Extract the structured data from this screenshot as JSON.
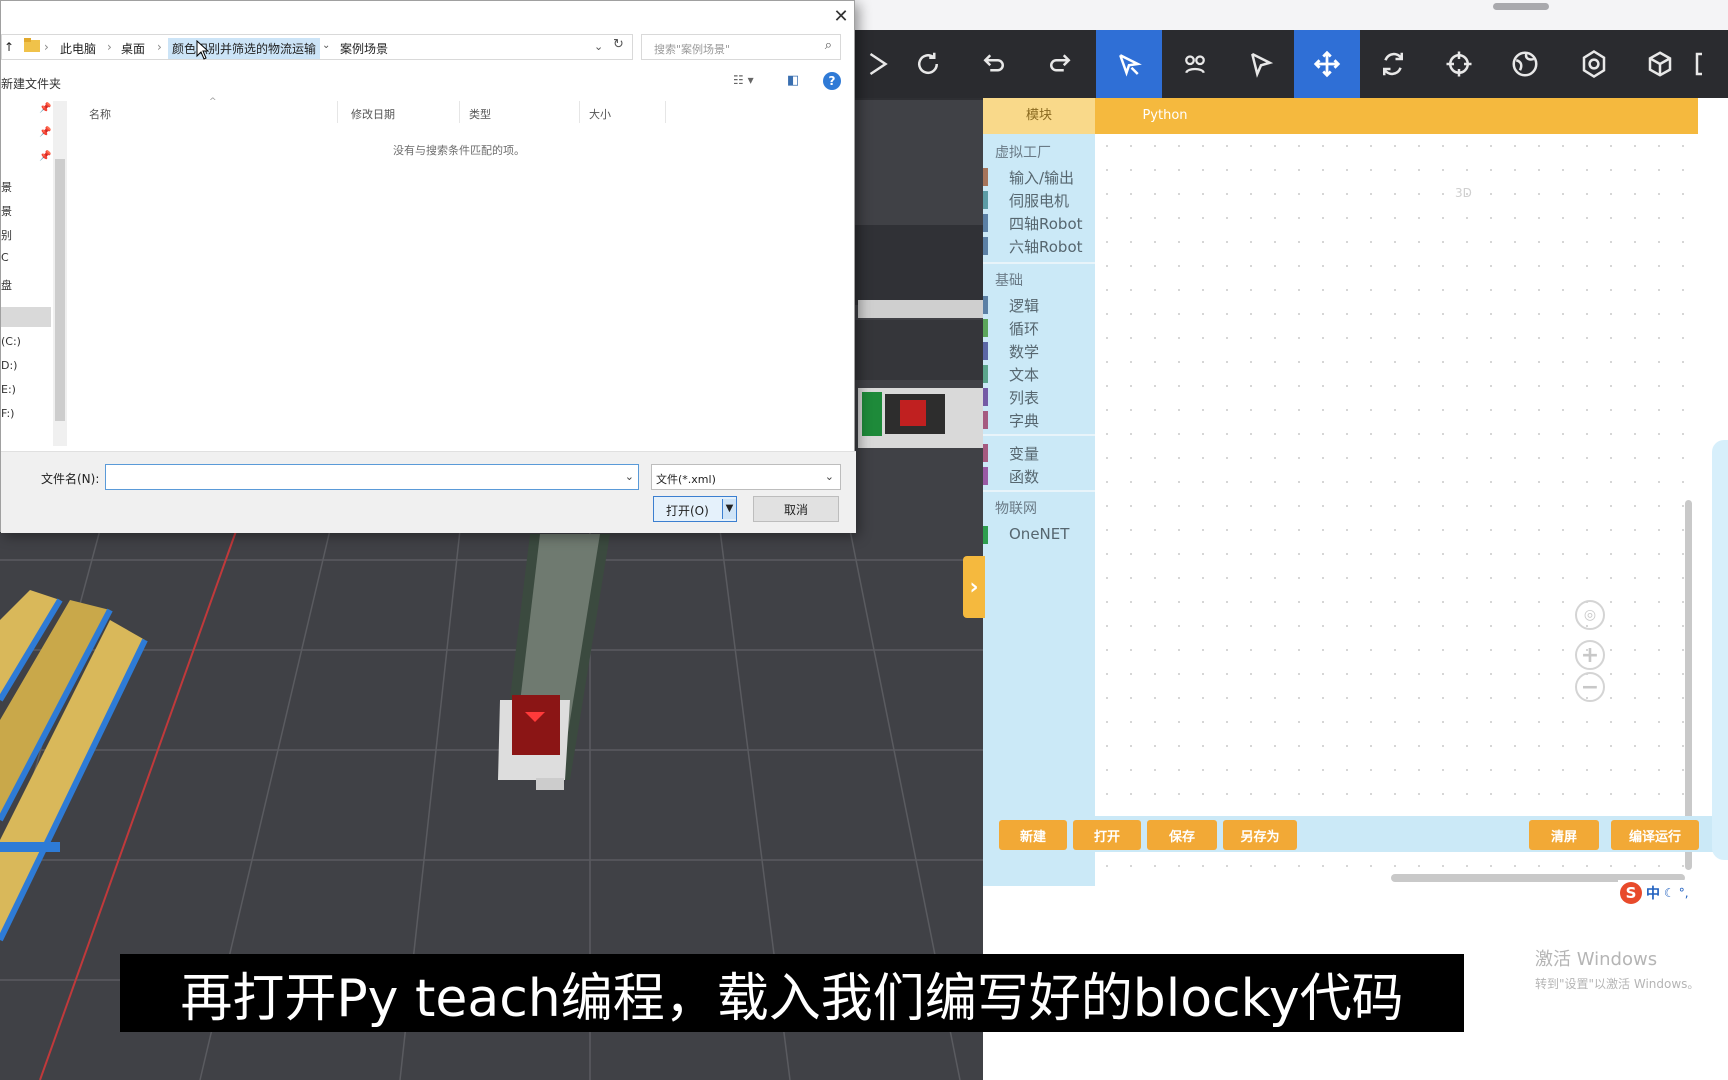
{
  "dialog": {
    "address": {
      "crumbs": [
        "此电脑",
        "桌面"
      ],
      "selected_folder": "颜色识别并筛选的物流运输",
      "subfolder": "案例场景"
    },
    "search_placeholder": "搜索\"案例场景\"",
    "new_folder": "新建文件夹",
    "columns": [
      "名称",
      "修改日期",
      "类型",
      "大小"
    ],
    "empty_message": "没有与搜索条件匹配的项。",
    "nav_items": [
      "景",
      "景",
      "别",
      "C",
      "盘",
      "(C:)",
      "D:)",
      "E:)",
      "F:)"
    ],
    "filename_label": "文件名(N):",
    "filename_value": "",
    "filetype": "文件(*.xml)",
    "open_button": "打开(O)",
    "cancel_button": "取消"
  },
  "toolbar": {
    "active_indices": [
      4,
      7
    ],
    "icons": [
      "play-icon",
      "redo-circle-icon",
      "undo-icon",
      "redo-icon",
      "magic-select-icon",
      "multi-paw-icon",
      "pointer-icon",
      "move-icon",
      "rotate-icon",
      "crosshair-icon",
      "globe-icon",
      "settings-icon",
      "cube-icon"
    ]
  },
  "blockly": {
    "tabs": [
      "模块",
      "Python"
    ],
    "categories": [
      {
        "title": "虚拟工厂",
        "items": [
          {
            "label": "输入/输出",
            "color": "#a5745b"
          },
          {
            "label": "伺服电机",
            "color": "#5b9ba5"
          },
          {
            "label": "四轴Robot",
            "color": "#5b80a5"
          },
          {
            "label": "六轴Robot",
            "color": "#5b80a5"
          }
        ]
      },
      {
        "title": "基础",
        "items": [
          {
            "label": "逻辑",
            "color": "#5b80a5"
          },
          {
            "label": "循环",
            "color": "#5ba55b"
          },
          {
            "label": "数学",
            "color": "#5b67a5"
          },
          {
            "label": "文本",
            "color": "#5ba58c"
          },
          {
            "label": "列表",
            "color": "#745ba5"
          },
          {
            "label": "字典",
            "color": "#a55b80"
          }
        ]
      },
      {
        "title": "",
        "items": [
          {
            "label": "变量",
            "color": "#a55b80"
          },
          {
            "label": "函数",
            "color": "#995ba5"
          }
        ]
      },
      {
        "title": "物联网",
        "items": [
          {
            "label": "OneNET",
            "color": "#2e9e4f"
          }
        ]
      }
    ],
    "workspace_ghost": "3D",
    "buttons_left": [
      "新建",
      "打开",
      "保存",
      "另存为"
    ],
    "buttons_right": [
      "清屏",
      "编译运行"
    ],
    "accent": "#f5b93e"
  },
  "ime": {
    "logo": "S",
    "mode": "中"
  },
  "activate": {
    "line1": "激活 Windows",
    "line2": "转到\"设置\"以激活 Windows。"
  },
  "subtitle": "再打开Py teach编程，载入我们编写好的blocky代码"
}
